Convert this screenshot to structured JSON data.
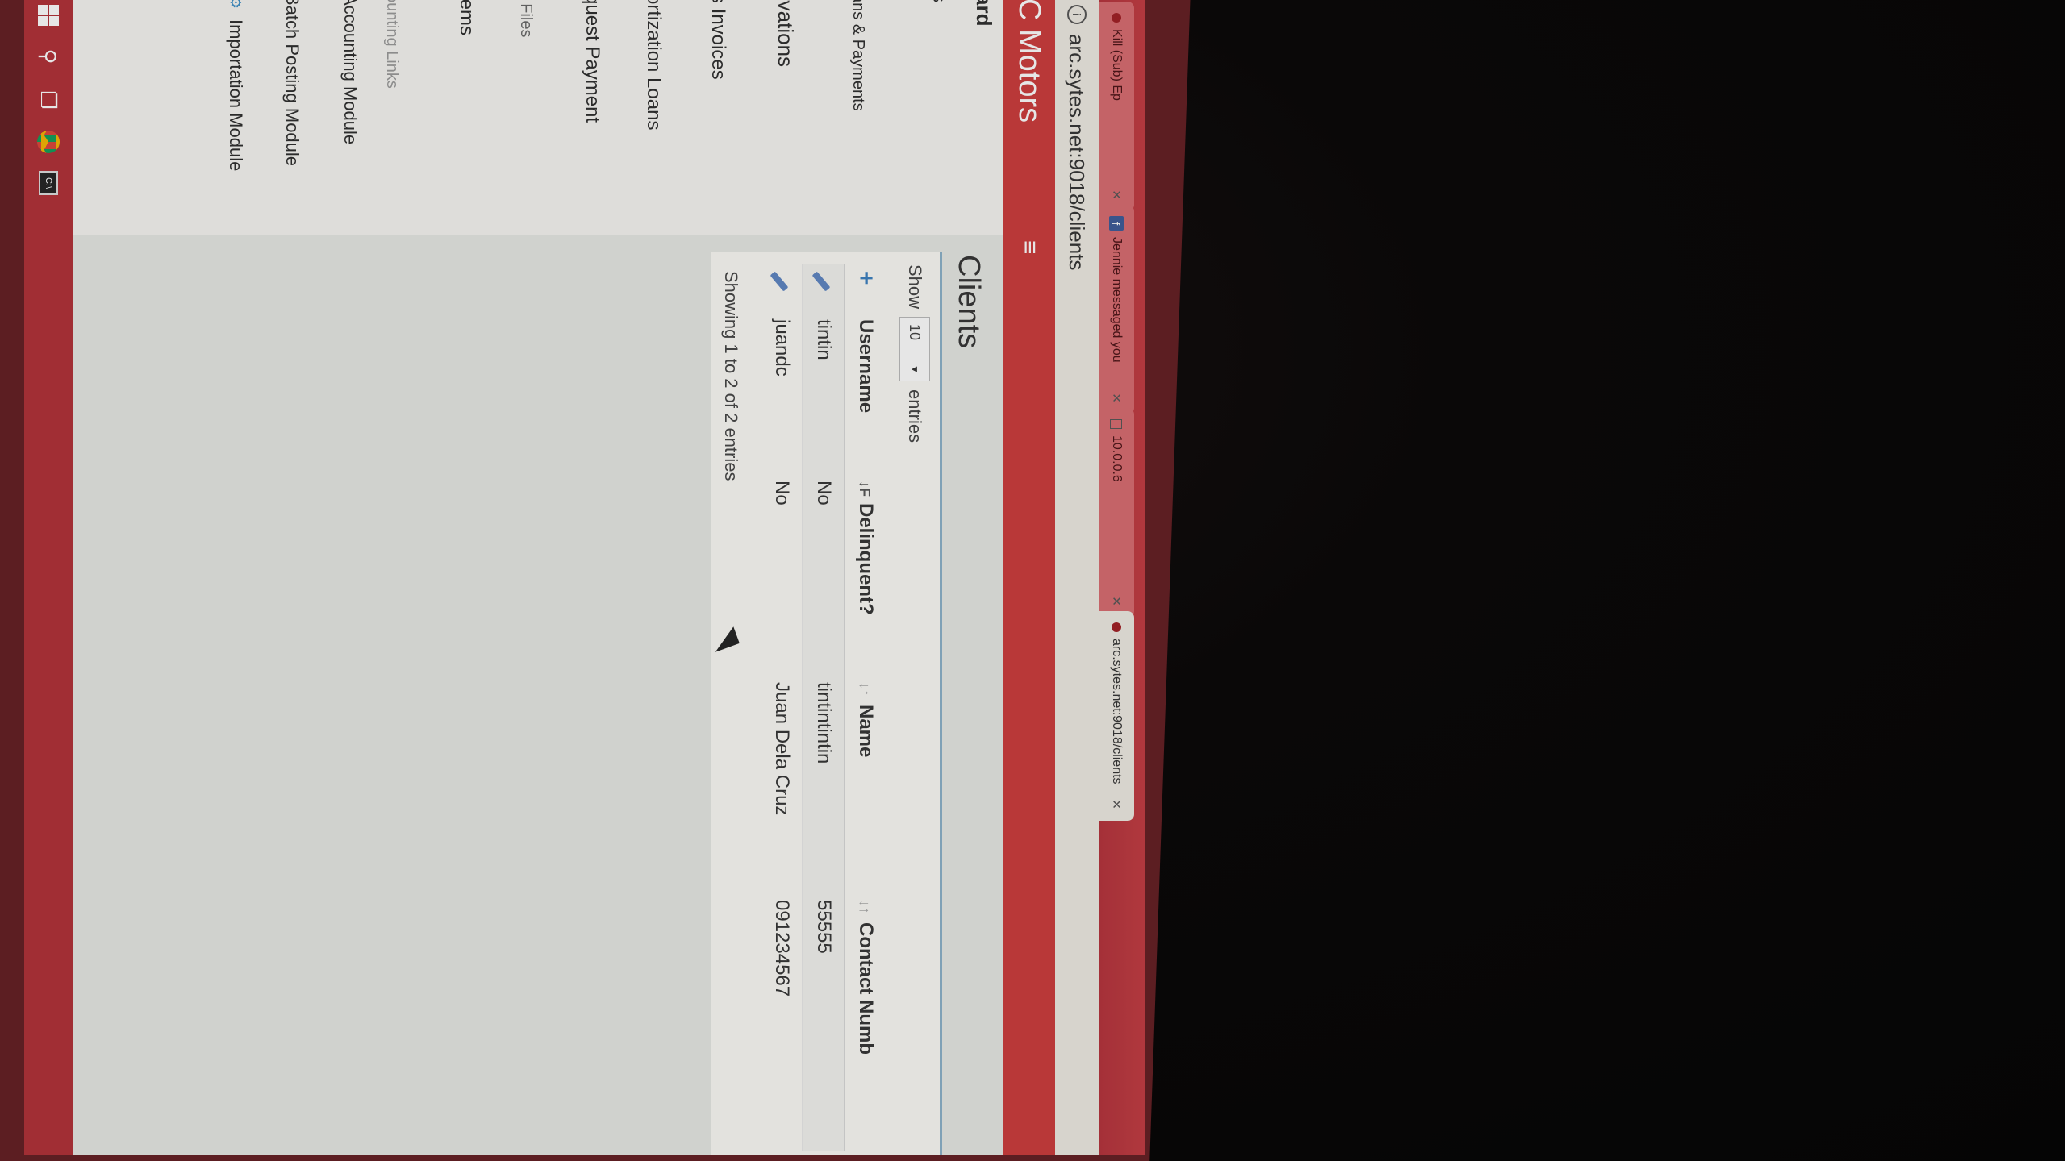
{
  "browser": {
    "tabs": [
      {
        "label": "Kill (Sub) Ep",
        "icon": "red-dot-icon",
        "active": false
      },
      {
        "label": "Jennie messaged you",
        "icon": "facebook-icon",
        "active": false
      },
      {
        "label": "10.0.0.6",
        "icon": "document-icon",
        "active": false
      },
      {
        "label": "arc.sytes.net:9018/clients",
        "icon": "red-dot-icon",
        "active": true
      }
    ],
    "url": "arc.sytes.net:9018/clients",
    "info_icon_glyph": "i"
  },
  "app": {
    "brand": "C Motors",
    "hamburger_glyph": "≡",
    "accent_color": "#cc3a3a"
  },
  "sidebar": {
    "items": [
      {
        "label": "ard",
        "icon": ""
      },
      {
        "label": "s",
        "icon": ""
      },
      {
        "label": "ans & Payments",
        "icon": ""
      },
      {
        "label": "rvations",
        "icon": ""
      },
      {
        "label": "s Invoices",
        "icon": ""
      },
      {
        "label": "ortization Loans",
        "icon": ""
      },
      {
        "label": "quest Payment",
        "icon": ""
      },
      {
        "label": "r Files",
        "icon": ""
      },
      {
        "label": "tems",
        "icon": ""
      },
      {
        "label": "ounting Links",
        "icon": ""
      },
      {
        "label": "Accounting Module",
        "icon": ""
      },
      {
        "label": "Batch Posting Module",
        "icon": ""
      },
      {
        "label": "Importation Module",
        "icon": "gear-icon"
      }
    ]
  },
  "page": {
    "title": "Clients",
    "length_menu": {
      "prefix": "Show",
      "value": "10",
      "suffix": "entries"
    },
    "table": {
      "columns": [
        "Username",
        "Delinquent?",
        "Name",
        "Contact Numb"
      ],
      "rows": [
        {
          "username": "tintin",
          "delinquent": "No",
          "name": "tintintintin",
          "contact": "55555"
        },
        {
          "username": "juandc",
          "delinquent": "No",
          "name": "Juan Dela Cruz",
          "contact": "091234567"
        }
      ]
    },
    "info": "Showing 1 to 2 of 2 entries"
  },
  "taskbar": {
    "icons": [
      "windows-start-icon",
      "search-icon",
      "task-view-icon",
      "chrome-icon",
      "command-prompt-icon"
    ],
    "cmd_label": "C:\\"
  }
}
